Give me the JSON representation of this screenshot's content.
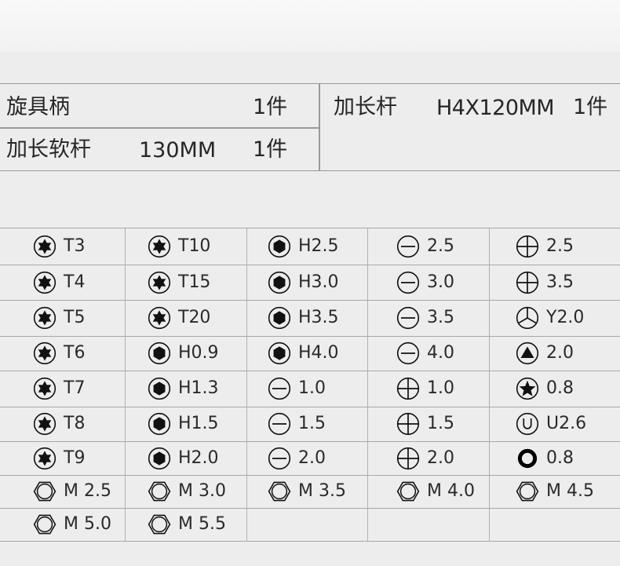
{
  "components": {
    "row1_left": {
      "name": "旋具柄",
      "qty": "1件"
    },
    "row1_right": {
      "name": "加长杆",
      "spec": "H4X120MM",
      "qty": "1件"
    },
    "row2_left": {
      "name": "加长软杆",
      "spec": "130MM",
      "qty": "1件"
    }
  },
  "bits": [
    [
      {
        "icon": "torx-star-icon",
        "label": "T3"
      },
      {
        "icon": "torx-star-icon",
        "label": "T10"
      },
      {
        "icon": "hex-socket-icon",
        "label": "H2.5"
      },
      {
        "icon": "slotted-icon",
        "label": "2.5"
      },
      {
        "icon": "phillips-icon",
        "label": "2.5"
      }
    ],
    [
      {
        "icon": "torx-star-icon",
        "label": "T4"
      },
      {
        "icon": "torx-star-icon",
        "label": "T15"
      },
      {
        "icon": "hex-socket-icon",
        "label": "H3.0"
      },
      {
        "icon": "slotted-icon",
        "label": "3.0"
      },
      {
        "icon": "phillips-icon",
        "label": "3.5"
      }
    ],
    [
      {
        "icon": "torx-star-icon",
        "label": "T5"
      },
      {
        "icon": "torx-star-icon",
        "label": "T20"
      },
      {
        "icon": "hex-socket-icon",
        "label": "H3.5"
      },
      {
        "icon": "slotted-icon",
        "label": "3.5"
      },
      {
        "icon": "tri-wing-y-icon",
        "label": "Y2.0"
      }
    ],
    [
      {
        "icon": "torx-star-icon",
        "label": "T6"
      },
      {
        "icon": "hex-socket-icon",
        "label": "H0.9"
      },
      {
        "icon": "hex-socket-icon",
        "label": "H4.0"
      },
      {
        "icon": "slotted-icon",
        "label": "4.0"
      },
      {
        "icon": "triangle-icon",
        "label": "2.0"
      }
    ],
    [
      {
        "icon": "torx-star-icon",
        "label": "T7"
      },
      {
        "icon": "hex-socket-icon",
        "label": "H1.3"
      },
      {
        "icon": "slotted-icon",
        "label": "1.0"
      },
      {
        "icon": "phillips-icon",
        "label": "1.0"
      },
      {
        "icon": "pentalobe-star-icon",
        "label": "0.8"
      }
    ],
    [
      {
        "icon": "torx-star-icon",
        "label": "T8"
      },
      {
        "icon": "hex-socket-icon",
        "label": "H1.5"
      },
      {
        "icon": "slotted-icon",
        "label": "1.5"
      },
      {
        "icon": "phillips-icon",
        "label": "1.5"
      },
      {
        "icon": "u-shape-icon",
        "label": "U2.6"
      }
    ],
    [
      {
        "icon": "torx-star-icon",
        "label": "T9"
      },
      {
        "icon": "hex-socket-icon",
        "label": "H2.0"
      },
      {
        "icon": "slotted-icon",
        "label": "2.0"
      },
      {
        "icon": "phillips-icon",
        "label": "2.0"
      },
      {
        "icon": "ring-icon",
        "label": "0.8"
      }
    ],
    [
      {
        "icon": "hex-nut-icon",
        "label": "M 2.5"
      },
      {
        "icon": "hex-nut-icon",
        "label": "M 3.0"
      },
      {
        "icon": "hex-nut-icon",
        "label": "M 3.5"
      },
      {
        "icon": "hex-nut-icon",
        "label": "M 4.0"
      },
      {
        "icon": "hex-nut-icon",
        "label": "M 4.5"
      }
    ],
    [
      {
        "icon": "hex-nut-icon",
        "label": "M 5.0"
      },
      {
        "icon": "hex-nut-icon",
        "label": "M 5.5"
      },
      null,
      null,
      null
    ]
  ]
}
